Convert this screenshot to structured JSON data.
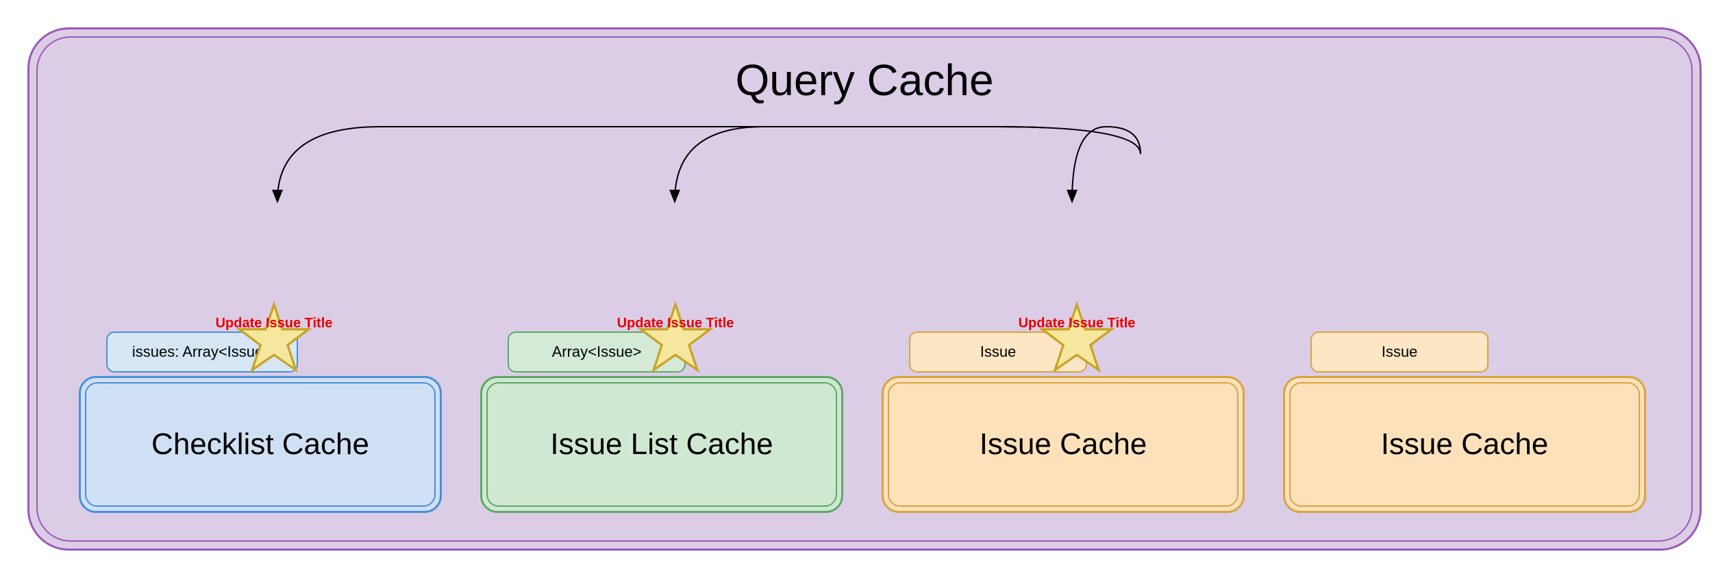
{
  "title": "Query Cache",
  "starLabel": "Update Issue Title",
  "caches": {
    "checklist": {
      "typeLabel": "issues: Array<Issue>",
      "name": "Checklist Cache"
    },
    "issueList": {
      "typeLabel": "Array<Issue>",
      "name": "Issue List Cache"
    },
    "issueCache1": {
      "typeLabel": "Issue",
      "name": "Issue Cache"
    },
    "issueCache2": {
      "typeLabel": "Issue",
      "name": "Issue Cache"
    }
  }
}
